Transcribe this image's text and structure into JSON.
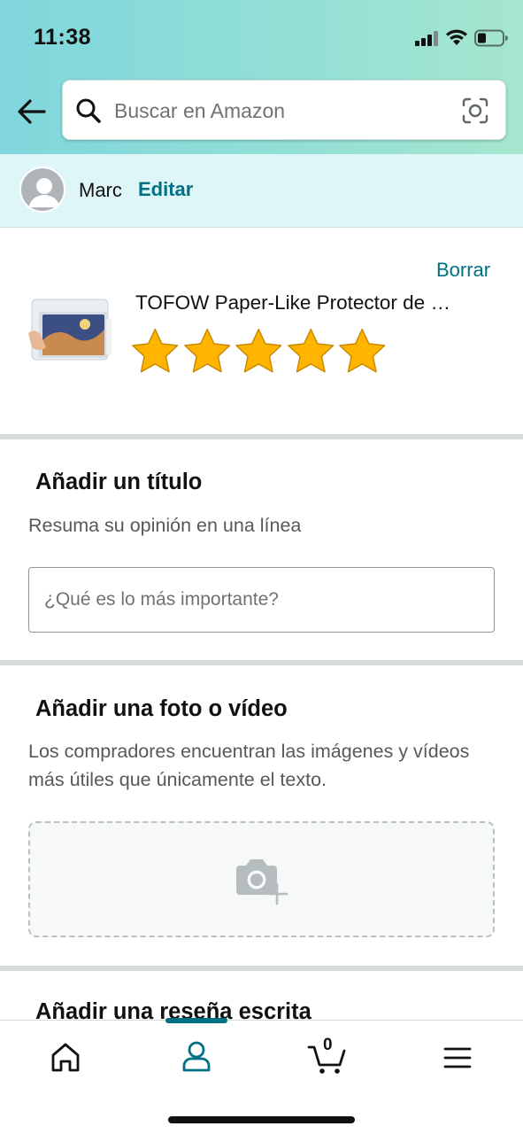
{
  "status_bar": {
    "time": "11:38"
  },
  "header": {
    "back_icon": "arrow-left-icon",
    "search": {
      "placeholder": "Buscar en Amazon",
      "value": ""
    },
    "camera_icon": "camera-scan-icon"
  },
  "user": {
    "name": "Marc",
    "edit_label": "Editar"
  },
  "product": {
    "delete_label": "Borrar",
    "title": "TOFOW Paper-Like Protector de …",
    "rating": 5,
    "rating_max": 5
  },
  "title_section": {
    "heading": "Añadir un título",
    "subtitle": "Resuma su opinión en una línea",
    "input_placeholder": "¿Qué es lo más importante?",
    "input_value": ""
  },
  "media_section": {
    "heading": "Añadir una foto o vídeo",
    "description": "Los compradores encuentran las imágenes y vídeos más útiles que únicamente el texto.",
    "upload_icon": "camera-plus-icon"
  },
  "review_section": {
    "heading": "Añadir una reseña escrita"
  },
  "tabbar": {
    "items": [
      {
        "icon": "home-icon",
        "active": false
      },
      {
        "icon": "user-icon",
        "active": true
      },
      {
        "icon": "cart-icon",
        "count": "0",
        "active": false
      },
      {
        "icon": "menu-icon",
        "active": false
      }
    ]
  },
  "colors": {
    "accent": "#007185",
    "star": "#ffb400"
  }
}
